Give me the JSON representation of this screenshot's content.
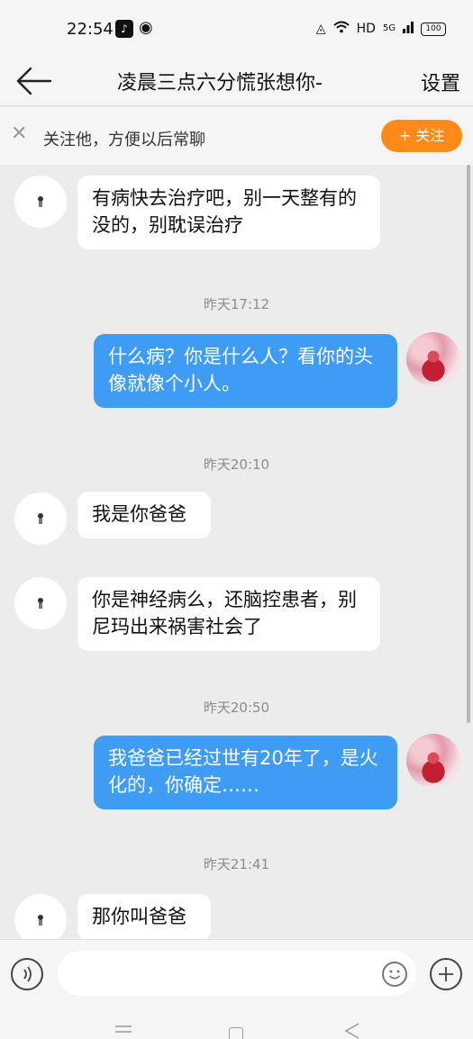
{
  "status_bar": {
    "time": "22:54",
    "network": "HD",
    "signal": "5G",
    "battery": "100",
    "icons": [
      "tiktok-icon",
      "weibo-icon",
      "alarm-icon",
      "wifi-icon",
      "signal-icon",
      "battery-icon"
    ]
  },
  "header": {
    "title": "凌晨三点六分慌张想你-",
    "settings_label": "设置",
    "back_icon": "back-arrow-icon"
  },
  "follow_banner": {
    "text": "关注他，方便以后常聊",
    "button_label": "+ 关注",
    "accent_color": "#ff8a1a"
  },
  "messages": [
    {
      "type": "in",
      "text": "有病快去治疗吧，别一天整有的没的，别耽误治疗"
    },
    {
      "type": "timestamp",
      "text": "昨天17:12"
    },
    {
      "type": "out",
      "text": "什么病？你是什么人？看你的头像就像个小人。"
    },
    {
      "type": "timestamp",
      "text": "昨天20:10"
    },
    {
      "type": "in",
      "text": "我是你爸爸"
    },
    {
      "type": "in",
      "text": "你是神经病么，还脑控患者，别尼玛出来祸害社会了"
    },
    {
      "type": "timestamp",
      "text": "昨天20:50"
    },
    {
      "type": "out",
      "text": "我爸爸已经过世有20年了，是火化的，你确定……"
    },
    {
      "type": "timestamp",
      "text": "昨天21:41"
    },
    {
      "type": "in",
      "text": "那你叫爸爸"
    }
  ],
  "colors": {
    "outgoing_bubble": "#3f9cf5",
    "incoming_bubble": "#ffffff",
    "chat_background": "#ececec"
  },
  "input_bar": {
    "placeholder": "",
    "icons": [
      "voice-icon",
      "emoji-icon",
      "plus-icon"
    ]
  },
  "system_nav": {
    "icons": [
      "menu-icon",
      "home-icon",
      "back-icon"
    ]
  }
}
